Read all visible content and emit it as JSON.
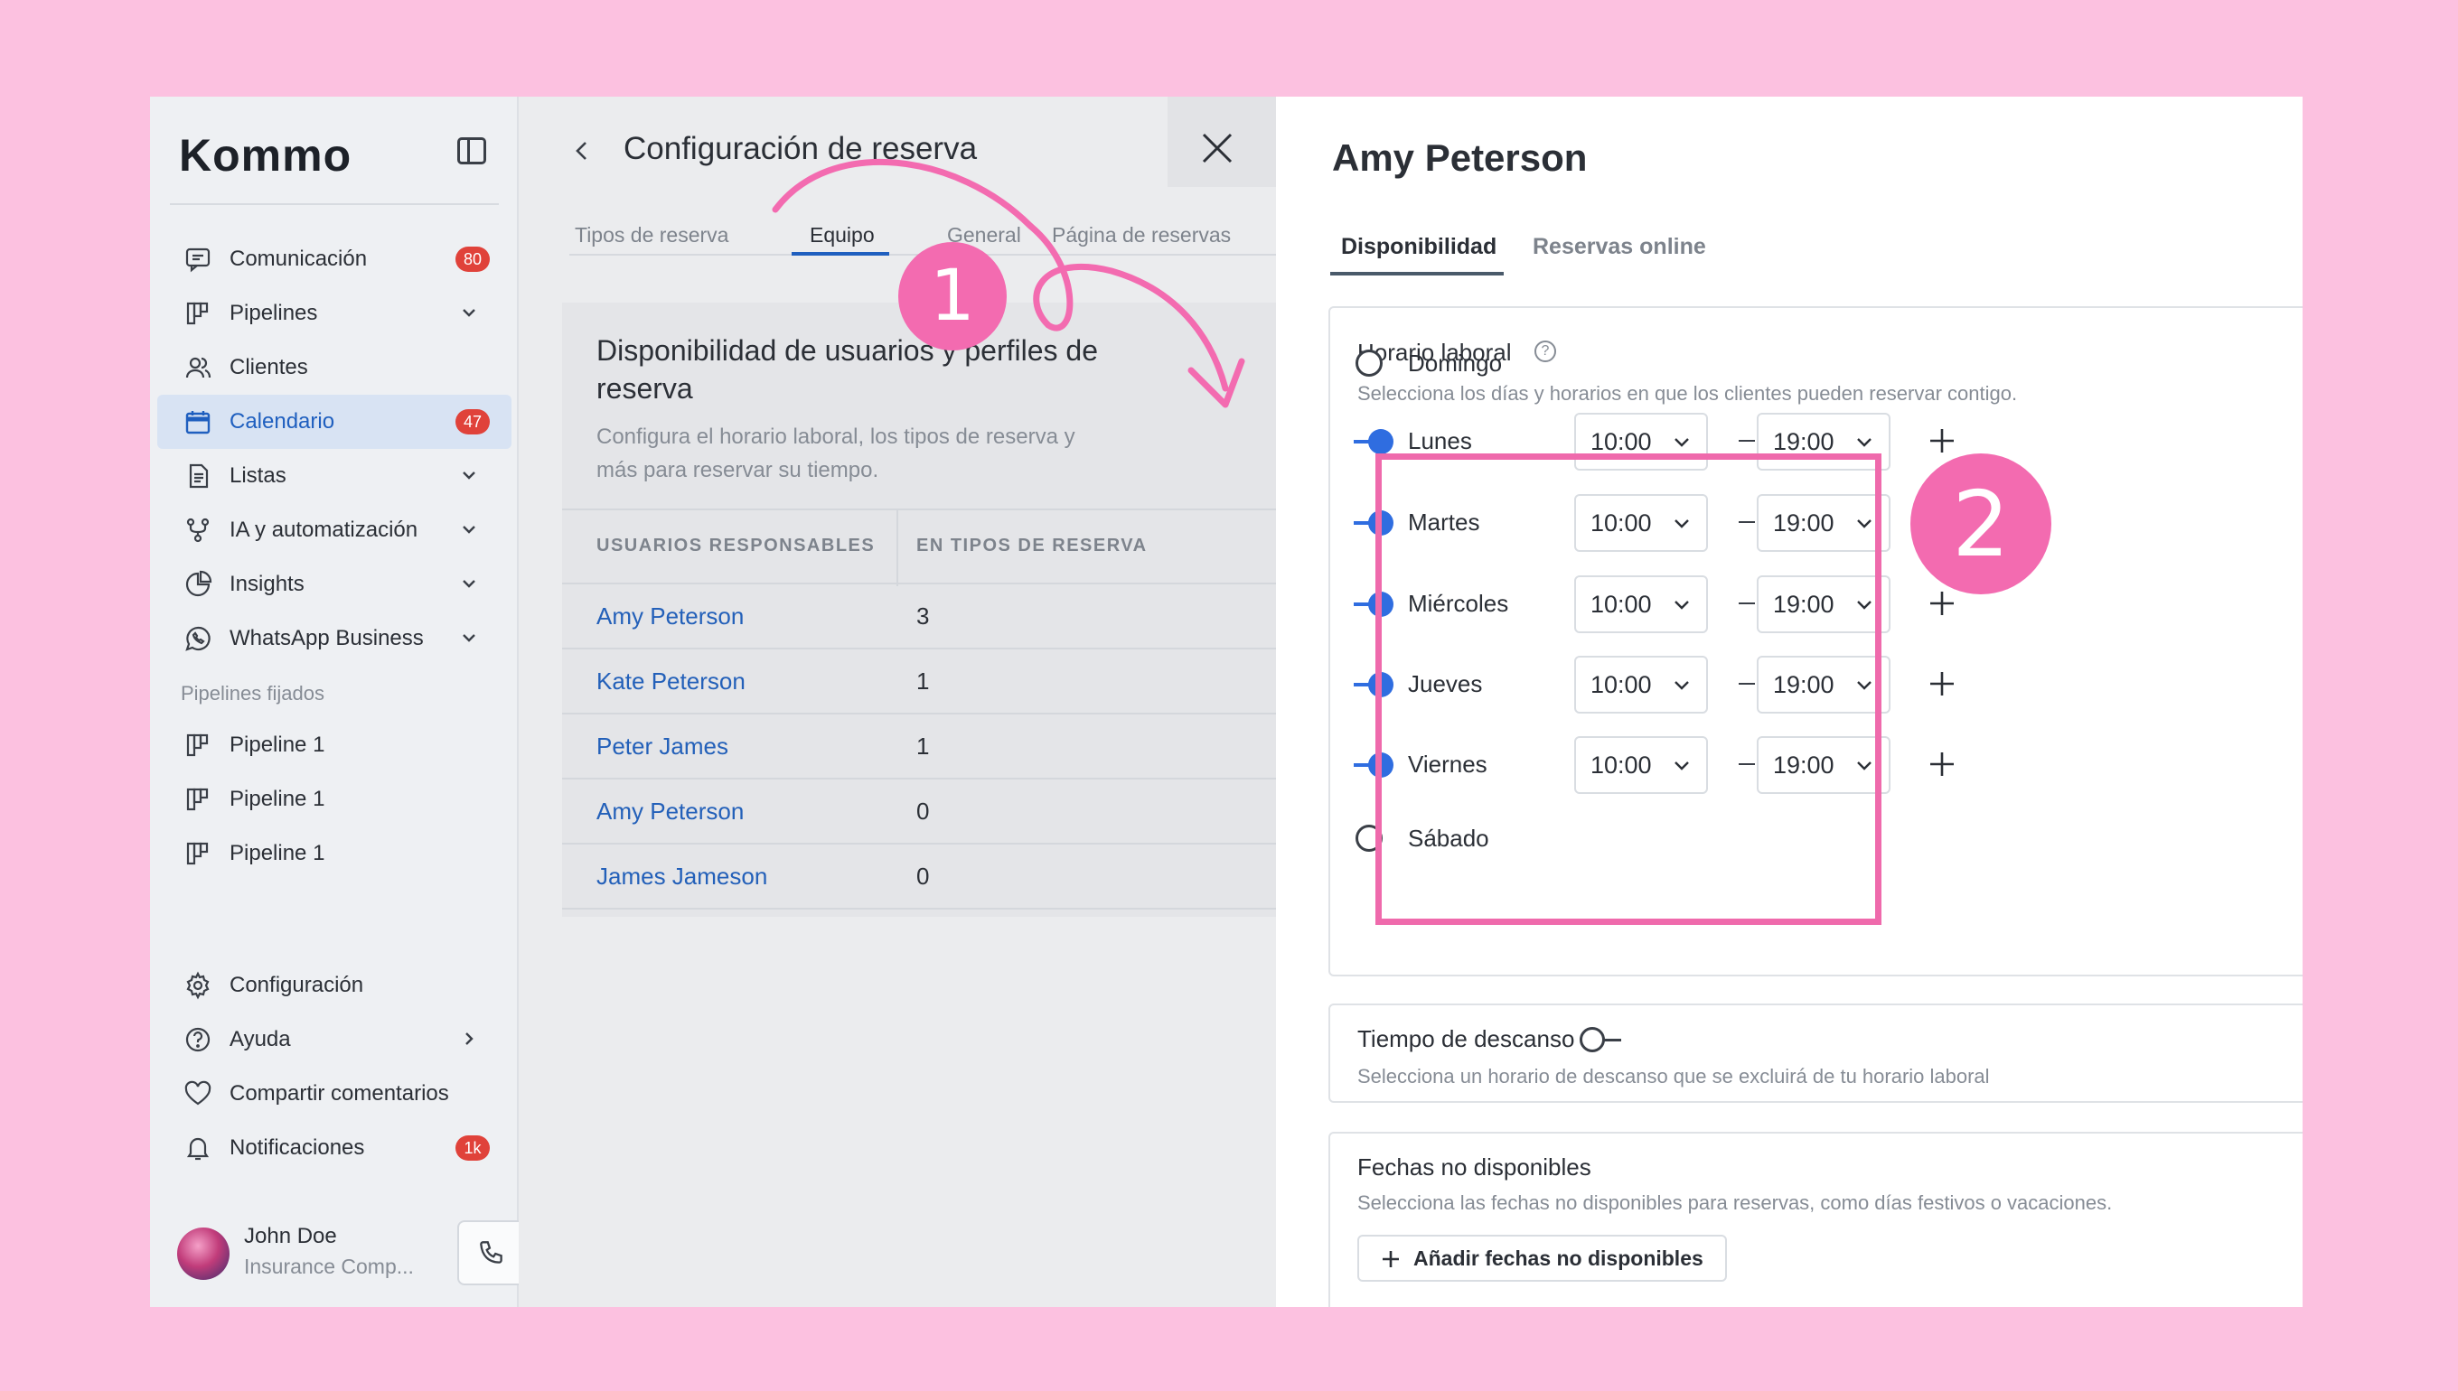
{
  "brand": {
    "logo_text": "Kommo",
    "accent": "#1f5fbf",
    "highlight": "#f36bb0"
  },
  "sidebar": {
    "items": [
      {
        "label": "Comunicación",
        "icon": "chat-icon",
        "badge": "80"
      },
      {
        "label": "Pipelines",
        "icon": "pipeline-icon",
        "chevron": "down"
      },
      {
        "label": "Clientes",
        "icon": "users-icon"
      },
      {
        "label": "Calendario",
        "icon": "calendar-icon",
        "badge": "47",
        "active": true
      },
      {
        "label": "Listas",
        "icon": "list-icon",
        "chevron": "down"
      },
      {
        "label": "IA y automatización",
        "icon": "automation-icon",
        "chevron": "down"
      },
      {
        "label": "Insights",
        "icon": "pie-chart-icon",
        "chevron": "down"
      },
      {
        "label": "WhatsApp Business",
        "icon": "whatsapp-icon",
        "chevron": "down"
      }
    ],
    "pinned_section_label": "Pipelines fijados",
    "pinned": [
      {
        "label": "Pipeline 1",
        "icon": "pipeline-icon"
      },
      {
        "label": "Pipeline 1",
        "icon": "pipeline-icon"
      },
      {
        "label": "Pipeline 1",
        "icon": "pipeline-icon"
      }
    ],
    "bottom": [
      {
        "label": "Configuración",
        "icon": "gear-icon"
      },
      {
        "label": "Ayuda",
        "icon": "help-icon",
        "chevron": "right"
      },
      {
        "label": "Compartir comentarios",
        "icon": "heart-icon"
      },
      {
        "label": "Notificaciones",
        "icon": "bell-icon",
        "badge": "1k"
      }
    ],
    "user": {
      "name": "John Doe",
      "company": "Insurance Comp..."
    }
  },
  "booking": {
    "title": "Configuración de reserva",
    "tabs": [
      "Tipos de reserva",
      "Equipo",
      "General",
      "Página de reservas"
    ],
    "active_tab": "Equipo",
    "card": {
      "title": "Disponibilidad de usuarios y perfiles de reserva",
      "description": "Configura el horario laboral, los tipos de reserva y más para reservar su tiempo.",
      "columns": [
        "USUARIOS RESPONSABLES",
        "EN TIPOS DE RESERVA"
      ],
      "rows": [
        {
          "name": "Amy Peterson",
          "count": "3"
        },
        {
          "name": "Kate Peterson",
          "count": "1"
        },
        {
          "name": "Peter James",
          "count": "1"
        },
        {
          "name": "Amy Peterson",
          "count": "0"
        },
        {
          "name": "James Jameson",
          "count": "0"
        }
      ]
    }
  },
  "detail": {
    "person": "Amy Peterson",
    "tabs": [
      "Disponibilidad",
      "Reservas online"
    ],
    "work_hours": {
      "title": "Horario laboral",
      "description": "Selecciona los días y horarios en que los clientes pueden reservar contigo.",
      "days": [
        {
          "day": "Domingo",
          "enabled": false
        },
        {
          "day": "Lunes",
          "enabled": true,
          "from": "10:00",
          "to": "19:00"
        },
        {
          "day": "Martes",
          "enabled": true,
          "from": "10:00",
          "to": "19:00"
        },
        {
          "day": "Miércoles",
          "enabled": true,
          "from": "10:00",
          "to": "19:00"
        },
        {
          "day": "Jueves",
          "enabled": true,
          "from": "10:00",
          "to": "19:00"
        },
        {
          "day": "Viernes",
          "enabled": true,
          "from": "10:00",
          "to": "19:00"
        },
        {
          "day": "Sábado",
          "enabled": false
        }
      ],
      "separator": "–"
    },
    "break_time": {
      "title": "Tiempo de descanso",
      "description": "Selecciona un horario de descanso que se excluirá de tu horario laboral",
      "enabled": false
    },
    "unavailable": {
      "title": "Fechas no disponibles",
      "description": "Selecciona las fechas no disponibles para reservas, como días festivos o vacaciones.",
      "button": "Añadir fechas no disponibles"
    }
  },
  "annotations": {
    "step1": "1",
    "step2": "2"
  }
}
